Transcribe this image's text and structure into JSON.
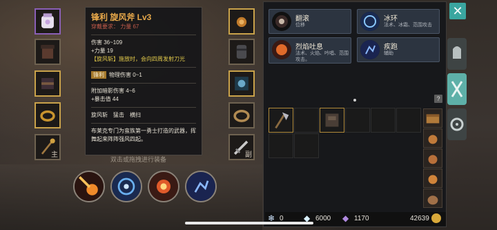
{
  "tooltip": {
    "title": "锋利 旋风斧 Lv3",
    "requirement": "穿戴要求： 力量 67",
    "damage": "伤害 36~109",
    "strength": "+力量 19",
    "skill_effect": "【旋风斩】施放时，会向四周发射刀光",
    "prefix_badge": "锋利",
    "prefix_effect": "物理伤害 0~1",
    "shadow_damage": "附加暗影伤害 4~6",
    "crit": "+暴击值 44",
    "skills": "旋风斩　猛击　横扫",
    "description": "布莱克专门为蛮族第一勇士打造的武器，挥舞起来阵阵强风四起。"
  },
  "hint": "双击或拖拽进行装备",
  "equipment_slots": {
    "main_hand_tag": "主",
    "off_hand_tag": "副"
  },
  "skills_panel": [
    {
      "name": "翻滚",
      "desc": "位移"
    },
    {
      "name": "冰环",
      "desc": "法术、冰霜、范围攻击"
    },
    {
      "name": "烈焰吐息",
      "desc": "法术、火焰、吟唱、范围攻击。"
    },
    {
      "name": "疾跑",
      "desc": "辅助"
    }
  ],
  "help_icon": "?",
  "currency": {
    "item_count": "0",
    "gems": "6000",
    "crystals": "1170",
    "gold": "42639"
  },
  "close_label": "✕",
  "colors": {
    "accent": "#3aa6a0",
    "title_orange": "#e7a84a",
    "requirement_red": "#c05a4a",
    "gold_border": "#c9a24a"
  }
}
